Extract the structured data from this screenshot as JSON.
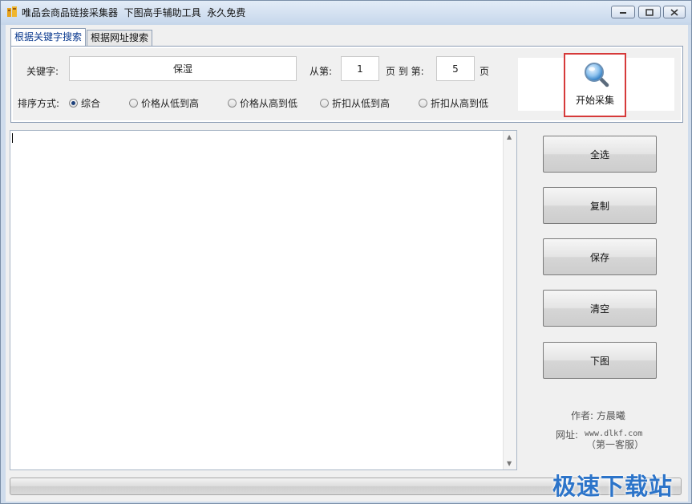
{
  "window": {
    "title": "唯品会商品链接采集器  下图高手辅助工具  永久免费",
    "controls": {
      "minimize_icon": "minimize-icon",
      "maximize_icon": "maximize-icon",
      "close_icon": "close-icon"
    }
  },
  "tabs": [
    {
      "label": "根据关键字搜索",
      "active": true
    },
    {
      "label": "根据网址搜索",
      "active": false
    }
  ],
  "search": {
    "keyword_label": "关键字:",
    "keyword_value": "保湿",
    "from_label": "从第:",
    "from_value": "1",
    "page_to_label": "页 到 第:",
    "to_value": "5",
    "page_label": "页"
  },
  "sort": {
    "label": "排序方式:",
    "options": [
      {
        "label": "综合",
        "selected": true
      },
      {
        "label": "价格从低到高",
        "selected": false
      },
      {
        "label": "价格从高到低",
        "selected": false
      },
      {
        "label": "折扣从低到高",
        "selected": false
      },
      {
        "label": "折扣从高到低",
        "selected": false
      }
    ]
  },
  "start_button": {
    "label": "开始采集",
    "icon": "magnifier-icon",
    "highlight_color": "#d63a3a"
  },
  "output": {
    "text": ""
  },
  "side_buttons": [
    {
      "label": "全选"
    },
    {
      "label": "复制"
    },
    {
      "label": "保存"
    },
    {
      "label": "清空"
    },
    {
      "label": "下图"
    }
  ],
  "footer": {
    "author": "作者: 方晨曦",
    "url_label": "网址:",
    "url": "www.dlkf.com",
    "url_note": "（第一客服）"
  },
  "progress": {
    "value": 0
  },
  "watermark": {
    "text": "极速下载站",
    "color": "#2c74c9"
  }
}
